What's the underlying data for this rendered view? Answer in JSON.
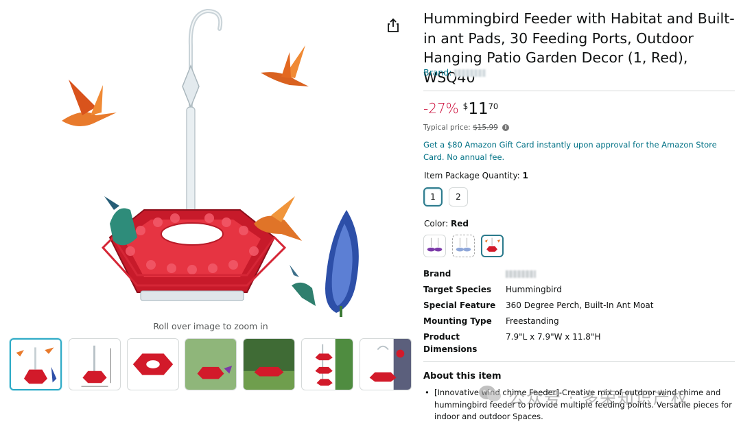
{
  "product": {
    "title": "Hummingbird Feeder with Habitat and Built-in ant Pads, 30 Feeding Ports, Outdoor Hanging Patio Garden Decor (1, Red), WSQ40",
    "brand_label": "Brand:"
  },
  "gallery": {
    "zoom_hint": "Roll over image to zoom in",
    "thumbnail_count": 7,
    "selected_index": 0
  },
  "price": {
    "discount": "-27%",
    "currency": "$",
    "whole": "11",
    "fraction": "70",
    "typical_label": "Typical price:",
    "typical_value": "$15.99"
  },
  "promo": {
    "text": "Get a $80 Amazon Gift Card instantly upon approval for the Amazon Store Card. No annual fee."
  },
  "quantity": {
    "label": "Item Package Quantity:",
    "selected": "1",
    "options": [
      "1",
      "2"
    ]
  },
  "color": {
    "label": "Color:",
    "selected": "Red"
  },
  "specs": [
    {
      "key": "Brand",
      "value": ""
    },
    {
      "key": "Target Species",
      "value": "Hummingbird"
    },
    {
      "key": "Special Feature",
      "value": "360 Degree Perch, Built-In Ant Moat"
    },
    {
      "key": "Mounting Type",
      "value": "Freestanding"
    },
    {
      "key": "Product Dimensions",
      "value": "7.9\"L x 7.9\"W x 11.8\"H"
    }
  ],
  "about": {
    "title": "About this item",
    "bullets": [
      "[Innovative wind chime Feeder]-Creative mix of outdoor wind chime and hummingbird feeder to provide multiple feeding points. Versatile pieces for indoor and outdoor Spaces."
    ]
  },
  "watermark": {
    "text": "公众号 · 多荣知识产权"
  },
  "colors": {
    "link": "#007185",
    "discount": "#cc0c39",
    "selected_border": "#2b7a8c",
    "feeder_red": "#d21a2a"
  }
}
